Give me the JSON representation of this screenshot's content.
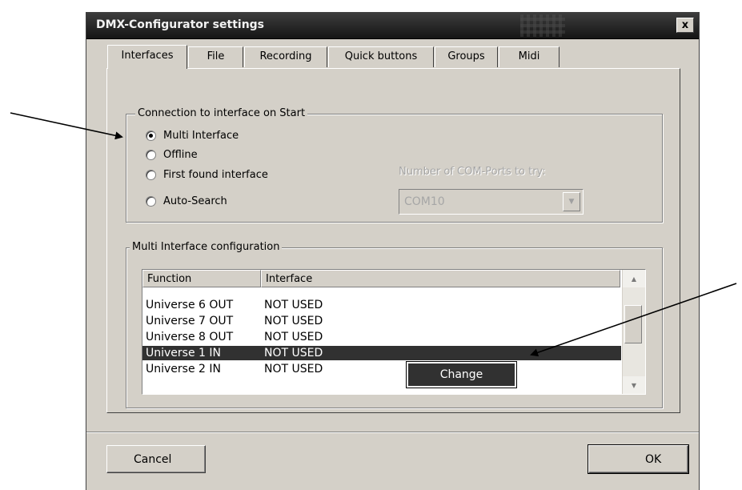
{
  "window": {
    "title": "DMX-Configurator settings",
    "close_glyph": "x"
  },
  "tabs": [
    {
      "label": "Interfaces",
      "active": true
    },
    {
      "label": "File"
    },
    {
      "label": "Recording"
    },
    {
      "label": "Quick buttons"
    },
    {
      "label": "Groups"
    },
    {
      "label": "Midi"
    }
  ],
  "connection": {
    "legend": "Connection to interface on Start",
    "options": [
      "Multi Interface",
      "Offline",
      "First found interface",
      "Auto-Search"
    ],
    "selected": "Multi Interface",
    "com_label": "Number of COM-Ports to try:",
    "com_value": "COM10"
  },
  "multi": {
    "legend": "Multi Interface configuration",
    "columns": [
      "Function",
      "Interface"
    ],
    "rows": [
      [
        "Universe 6 OUT",
        "NOT USED"
      ],
      [
        "Universe 7 OUT",
        "NOT USED"
      ],
      [
        "Universe 8 OUT",
        "NOT USED"
      ],
      [
        "Universe 1 IN",
        "NOT USED"
      ],
      [
        "Universe 2 IN",
        "NOT USED"
      ]
    ],
    "selected_row": "Universe 1 IN",
    "popup_label": "Change"
  },
  "buttons": {
    "cancel": "Cancel",
    "ok": "OK"
  },
  "colors": {
    "dialog_face": "#d4d0c8",
    "titlebar": "#1e1e1e",
    "selection": "#313131"
  }
}
